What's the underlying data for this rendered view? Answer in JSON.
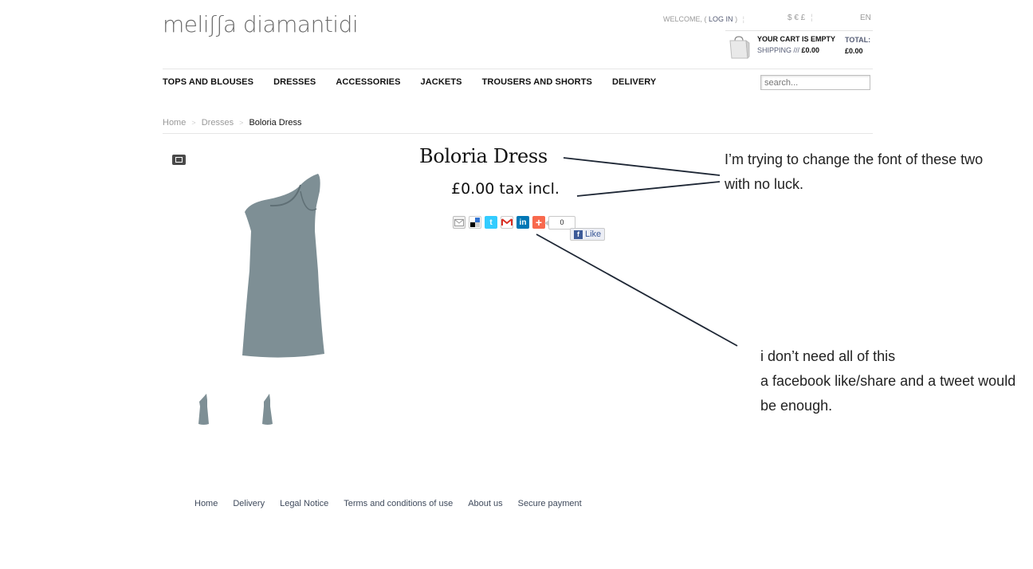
{
  "header": {
    "logo": "meliʃʃa  diamantidi",
    "welcome": "WELCOME, (",
    "login": "LOG IN",
    "welcome_close": ")",
    "currencies": "$ € £",
    "language": "EN",
    "cart_status": "YOUR CART IS EMPTY",
    "shipping_label": "SHIPPING ///",
    "shipping_value": "£0.00",
    "total_label": "TOTAL:",
    "total_value": "£0.00"
  },
  "nav": {
    "items": [
      "TOPS AND BLOUSES",
      "DRESSES",
      "ACCESSORIES",
      "JACKETS",
      "TROUSERS AND SHORTS",
      "DELIVERY"
    ],
    "search_placeholder": "search..."
  },
  "breadcrumb": {
    "home": "Home",
    "category": "Dresses",
    "current": "Boloria Dress",
    "arrow": ">"
  },
  "product": {
    "title": "Boloria Dress",
    "price": "£0.00 tax incl.",
    "share_count": "0",
    "fb_like": "Like",
    "dress_color": "#7e8f95"
  },
  "share_icons": [
    "email-icon",
    "delicious-icon",
    "twitter-icon",
    "gmail-icon",
    "linkedin-icon",
    "addthis-plus-icon"
  ],
  "annotations": {
    "note1_line1": "I’m trying to change the font of these two",
    "note1_line2": "with no luck.",
    "note2_line1": "i don’t need all of this",
    "note2_line2": "a facebook like/share and a tweet would",
    "note2_line3": "be enough."
  },
  "footer": {
    "links": [
      "Home",
      "Delivery",
      "Legal Notice",
      "Terms and conditions of use",
      "About us",
      "Secure payment"
    ]
  }
}
